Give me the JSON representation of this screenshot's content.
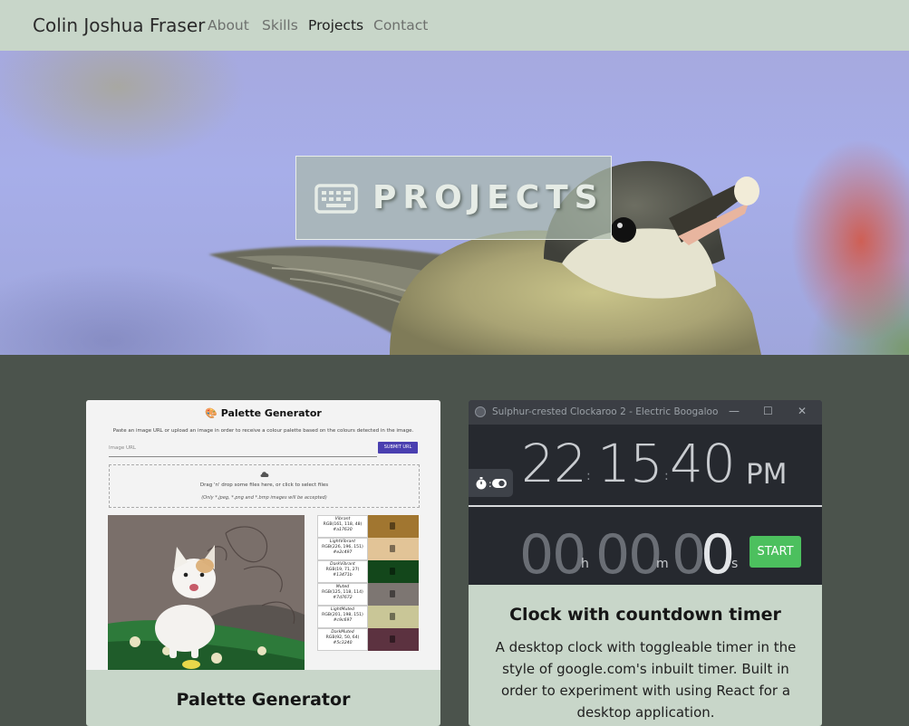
{
  "nav": {
    "brand": "Colin Joshua Fraser",
    "links": [
      "About",
      "Skills",
      "Projects",
      "Contact"
    ],
    "active": "Projects"
  },
  "hero": {
    "icon": "keyboard-icon",
    "title": "PROJECTS"
  },
  "cards": [
    {
      "title": "Palette Generator",
      "screenshot": {
        "heading": "Palette Generator",
        "heading_icon": "palette-icon",
        "intro": "Paste an image URL or upload an image in order to receive a colour palette based on the colours detected in the image.",
        "url_placeholder": "Image URL",
        "submit_label": "SUBMIT URL",
        "drop_text": "Drag 'n' drop some files here, or click to select files",
        "drop_note": "(Only *.jpeg, *.png and *.bmp images will be accepted)",
        "swatches": [
          {
            "name": "Vibrant",
            "rgb": "RGB(161, 118, 48)",
            "hex": "#a17630",
            "color": "#a17630"
          },
          {
            "name": "LightVibrant",
            "rgb": "RGB(226, 196, 151)",
            "hex": "#e2c497",
            "color": "#e2c497"
          },
          {
            "name": "DarkVibrant",
            "rgb": "RGB(19, 71, 27)",
            "hex": "#13471b",
            "color": "#13471b"
          },
          {
            "name": "Muted",
            "rgb": "RGB(125, 118, 114)",
            "hex": "#7d7672",
            "color": "#7d7672"
          },
          {
            "name": "LightMuted",
            "rgb": "RGB(201, 198, 151)",
            "hex": "#c9c697",
            "color": "#c9c697"
          },
          {
            "name": "DarkMuted",
            "rgb": "RGB(92, 50, 64)",
            "hex": "#5c3240",
            "color": "#5c3240"
          }
        ]
      }
    },
    {
      "title": "Clock with countdown timer",
      "description": "A desktop clock with toggleable timer in the style of google.com's inbuilt timer. Built in order to experiment with using React for a desktop application.",
      "screenshot": {
        "window_title": "Sulphur-crested Clockaroo 2 - Electric Boogaloo",
        "window_controls": [
          "—",
          "☐",
          "✕"
        ],
        "hours": "22",
        "minutes": "15",
        "seconds": "40",
        "separator": ":",
        "meridiem": "PM",
        "toggle_icons": [
          "stopwatch-icon",
          "toggle-icon"
        ],
        "timer": {
          "h": "00",
          "m": "00",
          "s_dim": "0",
          "s": "0",
          "h_unit": "h",
          "m_unit": "m",
          "s_unit": "s"
        },
        "start_label": "START"
      }
    }
  ],
  "colors": {
    "nav_bg": "#c8d6c9",
    "page_bg": "#4b534c",
    "card_bg": "#c8d6c9",
    "start_green": "#4cc05e"
  }
}
